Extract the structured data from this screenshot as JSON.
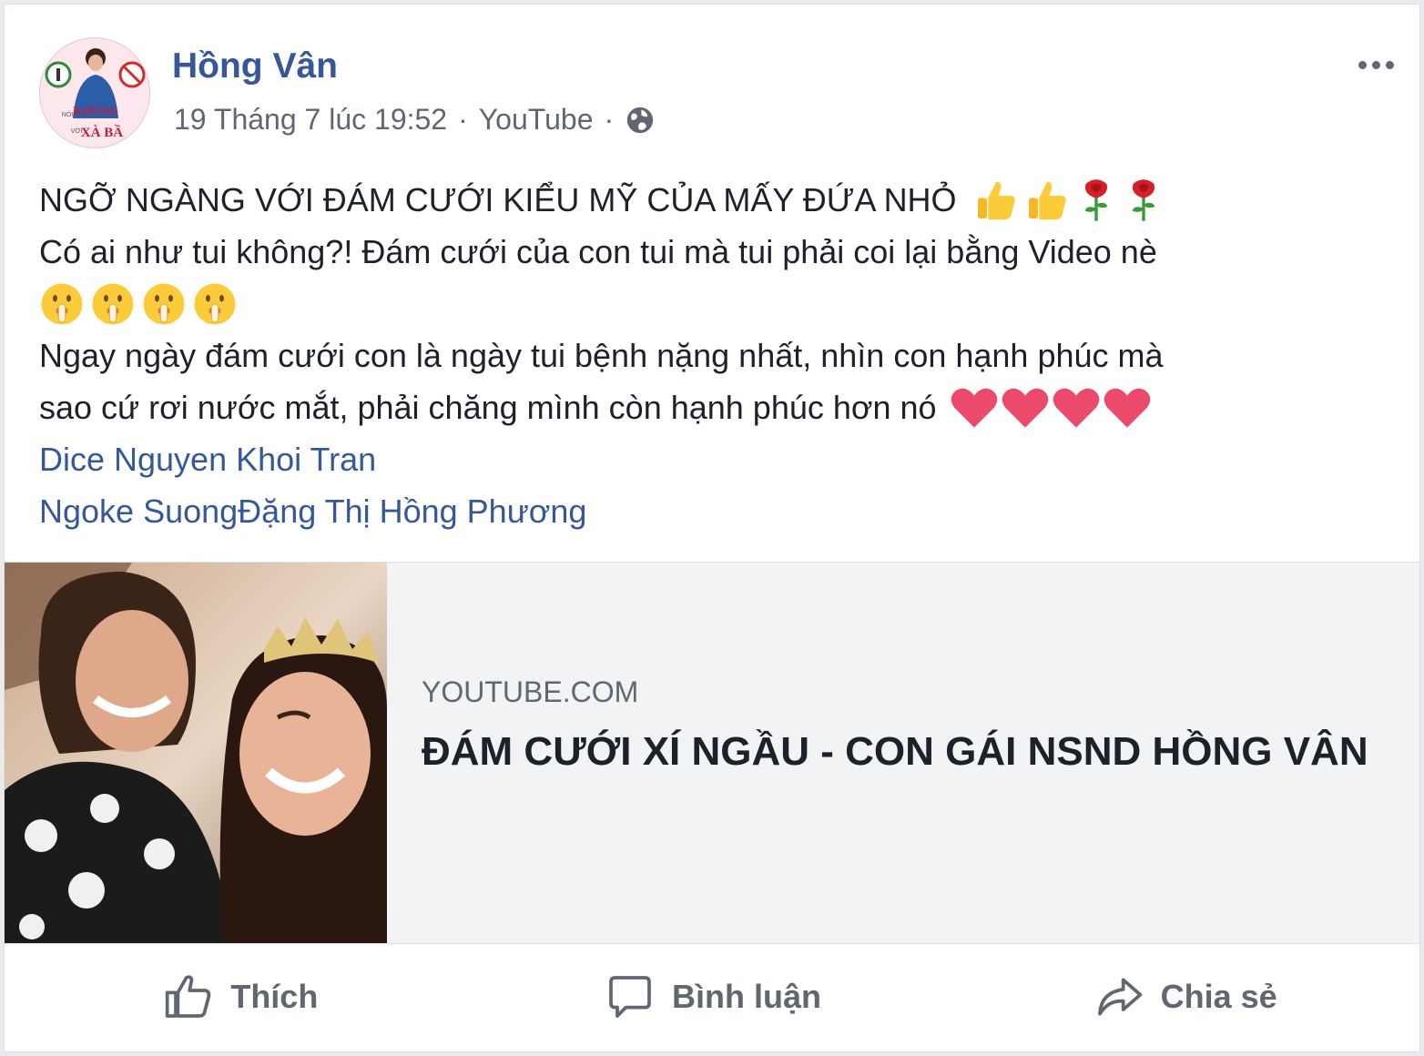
{
  "post": {
    "author": "Hồng Vân",
    "avatar_text": [
      "NÓI",
      "KHÔNG",
      "VỚI",
      "XÀ BẦ"
    ],
    "timestamp": "19 Tháng 7 lúc 19:52",
    "separator": "·",
    "source": "YouTube",
    "privacy_icon": "globe-icon",
    "body_lines": {
      "l1": "NGỠ NGÀNG VỚI ĐÁM CƯỚI KIỂU MỸ CỦA MẤY ĐỨA NHỎ",
      "l2": "Có ai như tui không?! Đám cưới của con tui mà tui phải coi lại bằng Video nè",
      "l4": "Ngay ngày đám cưới con là ngày tui bệnh nặng nhất, nhìn con hạnh phúc mà",
      "l5": "sao cứ rơi nước mắt, phải chăng mình còn hạnh phúc hơn nó"
    },
    "emoji": {
      "line1": [
        "thumbs-up",
        "thumbs-up",
        "rose",
        "rose"
      ],
      "line3": [
        "shushing-face",
        "shushing-face",
        "shushing-face",
        "shushing-face"
      ],
      "line5": [
        "heart",
        "heart",
        "heart",
        "heart"
      ]
    },
    "tags": {
      "line1": "Dice Nguyen Khoi Tran",
      "line2_a": "Ngoke Suong",
      "line2_b": "Đặng Thị Hồng Phương"
    }
  },
  "link_preview": {
    "domain": "YOUTUBE.COM",
    "title": "ĐÁM CƯỚI XÍ NGẦU - CON GÁI NSND HỒNG VÂN"
  },
  "actions": {
    "like": "Thích",
    "comment": "Bình luận",
    "share": "Chia sẻ"
  },
  "colors": {
    "link": "#365899",
    "text": "#1d2129",
    "secondary": "#616770",
    "preview_bg": "#f2f3f5"
  }
}
